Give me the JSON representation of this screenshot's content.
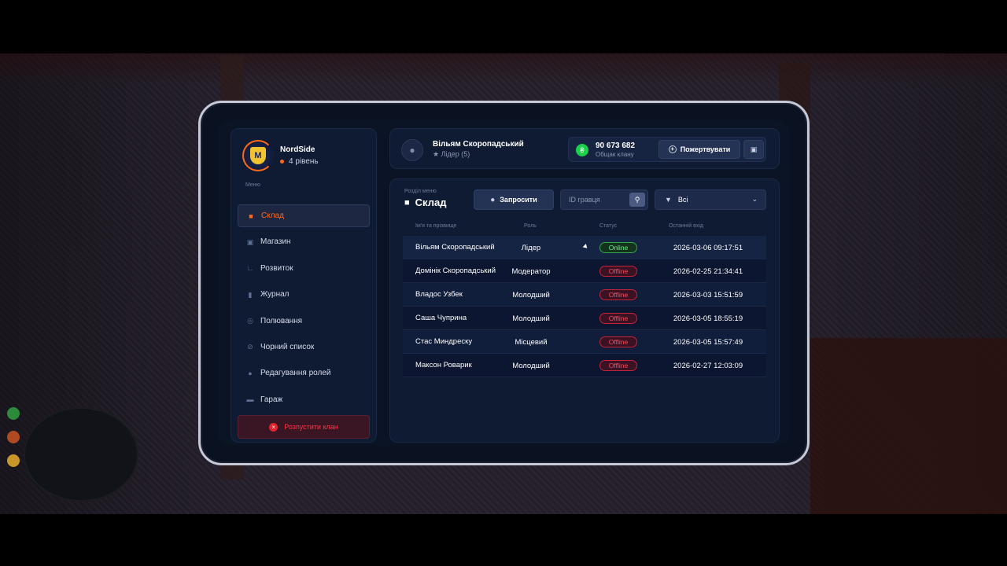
{
  "clan": {
    "name": "NordSide",
    "level": "4 рівень",
    "logo_letter": "M"
  },
  "menu_caption": "Меню",
  "nav": [
    {
      "label": "Склад",
      "icon": "users-icon",
      "active": true
    },
    {
      "label": "Магазин",
      "icon": "shop-icon"
    },
    {
      "label": "Розвиток",
      "icon": "chart-icon"
    },
    {
      "label": "Журнал",
      "icon": "book-icon"
    },
    {
      "label": "Полювання",
      "icon": "target-icon"
    },
    {
      "label": "Чорний список",
      "icon": "ban-icon"
    },
    {
      "label": "Редагування ролей",
      "icon": "user-edit-icon"
    },
    {
      "label": "Гараж",
      "icon": "car-icon"
    }
  ],
  "dissolve_label": "Розпустити клан",
  "user": {
    "name": "Вільям Скоропадський",
    "role": "Лідер (5)"
  },
  "bank": {
    "amount": "90 673 682",
    "label": "Общак клану"
  },
  "donate_label": "Пожертвувати",
  "section": {
    "caption": "Розділ меню",
    "title": "Склад"
  },
  "invite_label": "Запросити",
  "search": {
    "placeholder": "ID гравця"
  },
  "filter": {
    "value": "Всі"
  },
  "table": {
    "headers": [
      "Ім'я та прізвище",
      "Роль",
      "Статус",
      "Останній вхід"
    ],
    "rows": [
      {
        "name": "Вільям Скоропадський",
        "role": "Лідер",
        "status": "Online",
        "last": "2026-03-06 09:17:51"
      },
      {
        "name": "Домінік Скоропадський",
        "role": "Модератор",
        "status": "Offline",
        "last": "2026-02-25 21:34:41"
      },
      {
        "name": "Владос Узбек",
        "role": "Молодший",
        "status": "Offline",
        "last": "2026-03-03 15:51:59"
      },
      {
        "name": "Саша Чуприна",
        "role": "Молодший",
        "status": "Offline",
        "last": "2026-03-05 18:55:19"
      },
      {
        "name": "Стас Миндреску",
        "role": "Місцевий",
        "status": "Offline",
        "last": "2026-03-05 15:57:49"
      },
      {
        "name": "Максон Роварик",
        "role": "Молодший",
        "status": "Offline",
        "last": "2026-02-27 12:03:09"
      }
    ]
  },
  "colors": {
    "accent": "#ff6a1a",
    "online": "#2da84a",
    "offline": "#c4233a",
    "bank": "#19d14a"
  }
}
